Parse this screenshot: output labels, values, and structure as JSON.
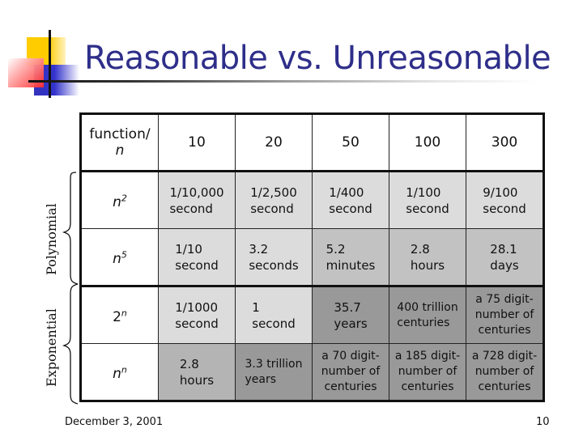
{
  "slide": {
    "title": "Reasonable vs. Unreasonable",
    "footer_date": "December 3, 2001",
    "page_number": "10",
    "colors": {
      "title": "#2e2e8a",
      "shade_light": "#dcdcdc",
      "shade_medium": "#c2c2c2",
      "shade_medium_dark": "#b4b4b4",
      "shade_dark": "#999999"
    }
  },
  "side_labels": {
    "polynomial": "Polynomial",
    "exponential": "Exponential"
  },
  "table": {
    "corner": {
      "line1": "function/",
      "line2": "n"
    },
    "columns": [
      "10",
      "20",
      "50",
      "100",
      "300"
    ],
    "rows": [
      {
        "function": {
          "base": "n",
          "exp": "2"
        },
        "group": "Polynomial",
        "cells": [
          {
            "l1": "1/10,000",
            "l2": "second",
            "shade": "light"
          },
          {
            "l1": "1/2,500",
            "l2": "second",
            "shade": "light"
          },
          {
            "l1": "1/400",
            "l2": "second",
            "shade": "light"
          },
          {
            "l1": "1/100",
            "l2": "second",
            "shade": "light"
          },
          {
            "l1": "9/100",
            "l2": "second",
            "shade": "light"
          }
        ]
      },
      {
        "function": {
          "base": "n",
          "exp": "5"
        },
        "group": "Polynomial",
        "cells": [
          {
            "l1": "1/10",
            "l2": "second",
            "shade": "light"
          },
          {
            "l1": "3.2",
            "l2": "seconds",
            "shade": "light"
          },
          {
            "l1": "5.2",
            "l2": "minutes",
            "shade": "medium"
          },
          {
            "l1": "2.8",
            "l2": "hours",
            "shade": "medium"
          },
          {
            "l1": "28.1",
            "l2": "days",
            "shade": "medium"
          }
        ]
      },
      {
        "function": {
          "base": "2",
          "exp": "n"
        },
        "group": "Exponential",
        "cells": [
          {
            "l1": "1/1000",
            "l2": "second",
            "shade": "light"
          },
          {
            "l1": "1",
            "l2": "second",
            "shade": "light"
          },
          {
            "l1": "35.7",
            "l2": "years",
            "shade": "dark"
          },
          {
            "l1": "400 trillion",
            "l2": "centuries",
            "shade": "dark"
          },
          {
            "l1": "a 75 digit-",
            "l2": "number of",
            "l3": "centuries",
            "shade": "dark"
          }
        ]
      },
      {
        "function": {
          "base": "n",
          "exp": "n"
        },
        "group": "Exponential",
        "cells": [
          {
            "l1": "2.8",
            "l2": "hours",
            "shade": "medium_dark"
          },
          {
            "l1": "3.3 trillion",
            "l2": "years",
            "shade": "dark"
          },
          {
            "l1": "a 70 digit-",
            "l2": "number of",
            "l3": "centuries",
            "shade": "dark"
          },
          {
            "l1": "a 185 digit-",
            "l2": "number of",
            "l3": "centuries",
            "shade": "dark"
          },
          {
            "l1": "a 728 digit-",
            "l2": "number of",
            "l3": "centuries",
            "shade": "dark"
          }
        ]
      }
    ]
  }
}
